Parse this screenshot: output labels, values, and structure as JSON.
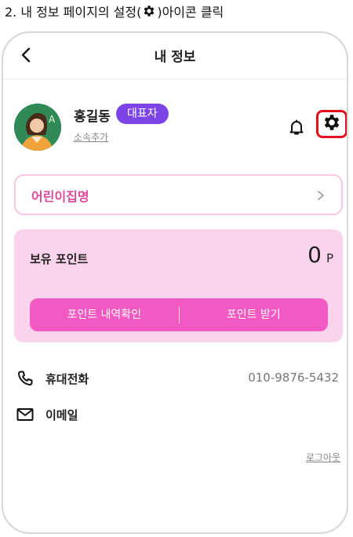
{
  "caption": {
    "prefix": "2. 내 정보 페이지의 설정(",
    "suffix": ")아이콘 클릭",
    "icon": "gear-icon"
  },
  "header": {
    "title": "내 정보",
    "back_icon": "chevron-left-icon"
  },
  "profile": {
    "name": "홍길동",
    "role_badge": "대표자",
    "affiliation_link": "소속추가",
    "notification_icon": "bell-icon",
    "settings_icon": "gear-icon"
  },
  "kindergarten": {
    "label": "어린이집명",
    "arrow_icon": "chevron-right-icon"
  },
  "points": {
    "label": "보유 포인트",
    "value": "0",
    "unit": "P",
    "history_button": "포인트 내역확인",
    "receive_button": "포인트 받기"
  },
  "contacts": {
    "phone": {
      "label": "휴대전화",
      "value": "010-9876-5432",
      "icon": "phone-icon"
    },
    "email": {
      "label": "이메일",
      "value": "",
      "icon": "mail-icon"
    }
  },
  "logout": "로그아웃",
  "colors": {
    "accent_purple": "#7c44e8",
    "accent_pink": "#f458c2",
    "points_bg": "#fcd3ec",
    "highlight_red": "#e0101c"
  }
}
